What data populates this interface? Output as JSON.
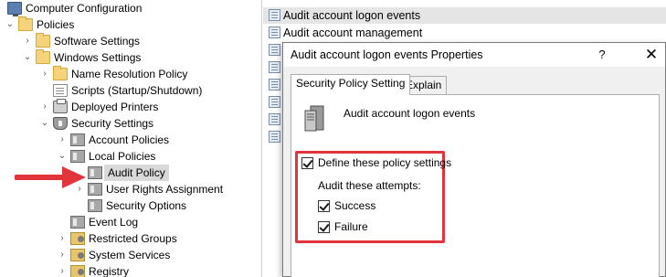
{
  "tree": {
    "items": [
      {
        "label": "Computer Configuration",
        "icon": "computer-icon",
        "expander": ""
      },
      {
        "label": "Policies",
        "icon": "folder-icon",
        "expander": "expanded"
      },
      {
        "label": "Software Settings",
        "icon": "folder-icon",
        "expander": "collapsed"
      },
      {
        "label": "Windows Settings",
        "icon": "folder-icon",
        "expander": "expanded"
      },
      {
        "label": "Name Resolution Policy",
        "icon": "folder-icon",
        "expander": "collapsed"
      },
      {
        "label": "Scripts (Startup/Shutdown)",
        "icon": "script-icon",
        "expander": ""
      },
      {
        "label": "Deployed Printers",
        "icon": "printer-icon",
        "expander": "collapsed"
      },
      {
        "label": "Security Settings",
        "icon": "security-icon",
        "expander": "expanded"
      },
      {
        "label": "Account Policies",
        "icon": "policy-icon",
        "expander": "collapsed"
      },
      {
        "label": "Local Policies",
        "icon": "policy-icon",
        "expander": "expanded"
      },
      {
        "label": "Audit Policy",
        "icon": "policy-icon",
        "expander": "",
        "selected": true
      },
      {
        "label": "User Rights Assignment",
        "icon": "policy-icon",
        "expander": "collapsed"
      },
      {
        "label": "Security Options",
        "icon": "policy-icon",
        "expander": ""
      },
      {
        "label": "Event Log",
        "icon": "policy-icon",
        "expander": ""
      },
      {
        "label": "Restricted Groups",
        "icon": "groups-icon",
        "expander": "collapsed"
      },
      {
        "label": "System Services",
        "icon": "services-icon",
        "expander": "collapsed"
      },
      {
        "label": "Registry",
        "icon": "registry-icon",
        "expander": "collapsed"
      }
    ]
  },
  "list": {
    "items": [
      {
        "label": "Audit account logon events",
        "selected": true
      },
      {
        "label": "Audit account management",
        "selected": false
      }
    ]
  },
  "dialog": {
    "title": "Audit account logon events Properties",
    "help_label": "?",
    "close_label": "✕",
    "tabs": [
      {
        "label": "Security Policy Setting",
        "active": true
      },
      {
        "label": "Explain",
        "active": false
      }
    ],
    "policy_name": "Audit account logon events",
    "define_label": "Define these policy settings",
    "define_checked": true,
    "attempts_label": "Audit these attempts:",
    "success_label": "Success",
    "success_checked": true,
    "failure_label": "Failure",
    "failure_checked": true
  },
  "colors": {
    "highlight": "#e2343b",
    "arrow": "#e2343b"
  }
}
